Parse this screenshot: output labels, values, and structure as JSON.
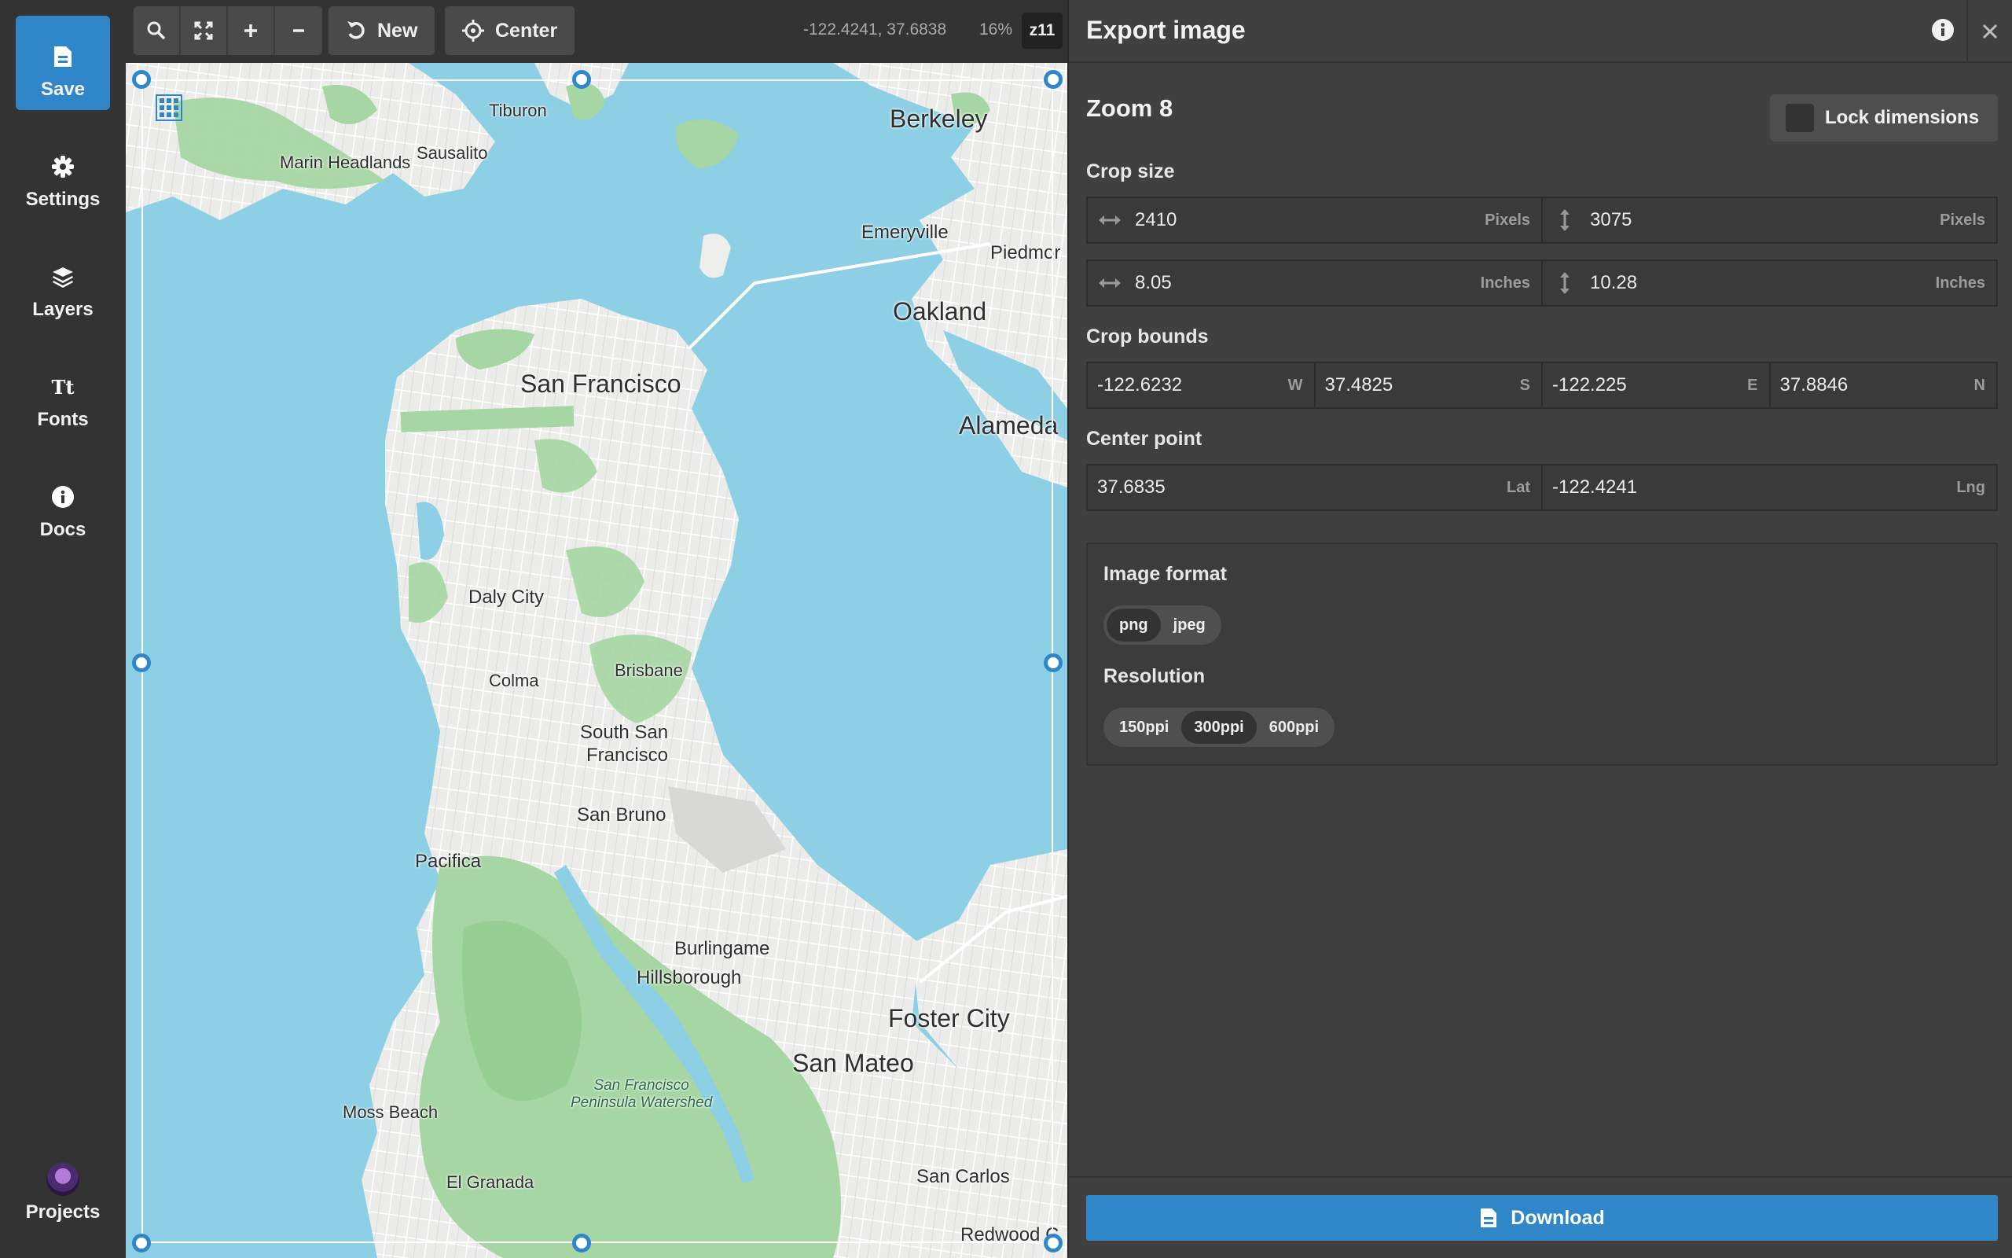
{
  "sidebar": {
    "items": [
      {
        "label": "Save",
        "icon": "save-icon"
      },
      {
        "label": "Settings",
        "icon": "gear-icon"
      },
      {
        "label": "Layers",
        "icon": "layers-icon"
      },
      {
        "label": "Fonts",
        "icon": "fonts-icon"
      },
      {
        "label": "Docs",
        "icon": "info-icon"
      },
      {
        "label": "Projects",
        "icon": "avatar"
      }
    ],
    "fonts_glyph": "Tt"
  },
  "toolbar": {
    "new_label": "New",
    "center_label": "Center",
    "coords": "-122.4241, 37.6838",
    "zoom_pct": "16%",
    "zoom_level": "z11"
  },
  "map": {
    "labels": {
      "tiburon": "Tiburon",
      "berkeley": "Berkeley",
      "marin": "Marin Headlands",
      "sausalito": "Sausalito",
      "emeryville": "Emeryville",
      "piedmont": "Piedmor",
      "oakland": "Oakland",
      "sf": "San Francisco",
      "alameda": "Alameda",
      "daly": "Daly City",
      "colma": "Colma",
      "brisbane": "Brisbane",
      "ssf1": "South San",
      "ssf2": "Francisco",
      "sanbruno": "San Bruno",
      "pacifica": "Pacifica",
      "burlingame": "Burlingame",
      "hillsborough": "Hillsborough",
      "foster": "Foster City",
      "sanmateo": "San Mateo",
      "watershed1": "San Francisco",
      "watershed2": "Peninsula Watershed",
      "moss": "Moss Beach",
      "elgranada": "El Granada",
      "sancarlos": "San Carlos",
      "redwood": "Redwood C"
    },
    "colors": {
      "water": "#8dcfe4",
      "land": "#eeeeec",
      "park": "#a6d6a3",
      "accent": "#2f87c9"
    }
  },
  "panel": {
    "title": "Export image",
    "zoom_title": "Zoom 8",
    "lock_label": "Lock dimensions",
    "crop_size_label": "Crop size",
    "width_px": "2410",
    "height_px": "3075",
    "pixels_unit": "Pixels",
    "width_in": "8.05",
    "height_in": "10.28",
    "inches_unit": "Inches",
    "crop_bounds_label": "Crop bounds",
    "bounds": [
      {
        "value": "-122.6232",
        "unit": "W"
      },
      {
        "value": "37.4825",
        "unit": "S"
      },
      {
        "value": "-122.225",
        "unit": "E"
      },
      {
        "value": "37.8846",
        "unit": "N"
      }
    ],
    "center_label": "Center point",
    "lat": "37.6835",
    "lat_unit": "Lat",
    "lng": "-122.4241",
    "lng_unit": "Lng",
    "format_label": "Image format",
    "formats": [
      "png",
      "jpeg"
    ],
    "format_selected": "png",
    "resolution_label": "Resolution",
    "resolutions": [
      "150ppi",
      "300ppi",
      "600ppi"
    ],
    "resolution_selected": "300ppi",
    "download_label": "Download"
  }
}
